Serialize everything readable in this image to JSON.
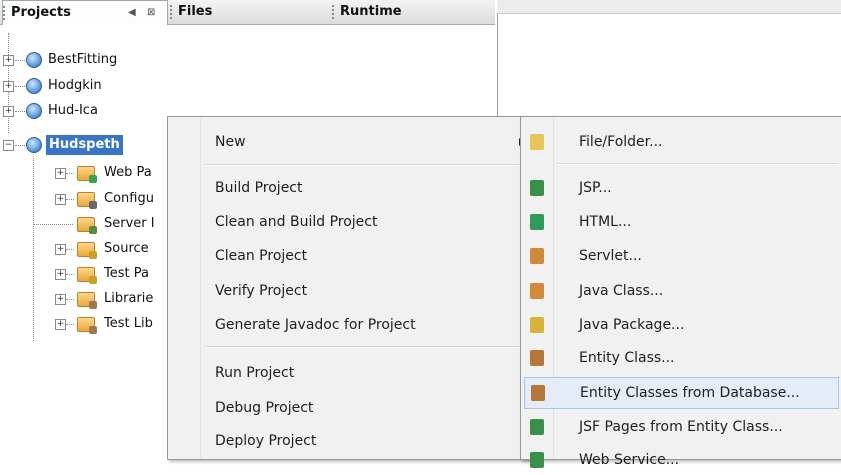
{
  "tabs": [
    {
      "label": "Projects",
      "active": true
    },
    {
      "label": "Files",
      "active": false
    },
    {
      "label": "Runtime",
      "active": false
    }
  ],
  "tab_controls": {
    "minimize_glyph": "◀",
    "close_glyph": "⊠"
  },
  "projects": [
    {
      "name": "BestFitting"
    },
    {
      "name": "Hodgkin"
    },
    {
      "name": "Hud-Ica"
    },
    {
      "name": "Hudspeth",
      "selected": true
    }
  ],
  "project_children": [
    {
      "name": "Web Pa",
      "icon": "web-pages-folder-icon",
      "accent": "#3aa34a"
    },
    {
      "name": "Configu",
      "icon": "configuration-folder-icon",
      "accent": "#6a6a6a"
    },
    {
      "name": "Server I",
      "icon": "server-resources-folder-icon",
      "accent": "#5a8a3a"
    },
    {
      "name": "Source",
      "icon": "source-packages-folder-icon",
      "accent": "#c9a227"
    },
    {
      "name": "Test Pa",
      "icon": "test-packages-folder-icon",
      "accent": "#c9a227"
    },
    {
      "name": "Librarie",
      "icon": "libraries-folder-icon",
      "accent": "#9b7b4a"
    },
    {
      "name": "Test Lib",
      "icon": "test-libraries-folder-icon",
      "accent": "#9b7b4a"
    }
  ],
  "context_menu": {
    "items": [
      {
        "label": "New",
        "submenu": true
      },
      {
        "label": "Build Project"
      },
      {
        "label": "Clean and Build Project"
      },
      {
        "label": "Clean Project"
      },
      {
        "label": "Verify Project"
      },
      {
        "label": "Generate Javadoc for Project"
      },
      {
        "label": "Run Project"
      },
      {
        "label": "Debug Project"
      },
      {
        "label": "Deploy Project"
      }
    ]
  },
  "submenu": {
    "items": [
      {
        "label": "File/Folder...",
        "icon": "new-file-icon",
        "color": "#e6c65a"
      },
      {
        "label": "JSP...",
        "icon": "jsp-file-icon",
        "color": "#3a8f4a"
      },
      {
        "label": "HTML...",
        "icon": "html-file-icon",
        "color": "#2f9a5a"
      },
      {
        "label": "Servlet...",
        "icon": "servlet-icon",
        "color": "#d08a3a"
      },
      {
        "label": "Java Class...",
        "icon": "java-class-icon",
        "color": "#d08a3a"
      },
      {
        "label": "Java Package...",
        "icon": "java-package-icon",
        "color": "#d9b23a"
      },
      {
        "label": "Entity Class...",
        "icon": "entity-class-icon",
        "color": "#b5763a"
      },
      {
        "label": "Entity Classes from Database...",
        "icon": "entity-database-icon",
        "color": "#b5763a",
        "highlighted": true
      },
      {
        "label": "JSF Pages from Entity Class...",
        "icon": "jsf-pages-icon",
        "color": "#3a8f4a"
      },
      {
        "label": "Web Service...",
        "icon": "web-service-icon",
        "color": "#3a8f4a"
      }
    ]
  },
  "colors": {
    "selection": "#3a74c7",
    "highlight": "#e3ecf7"
  }
}
